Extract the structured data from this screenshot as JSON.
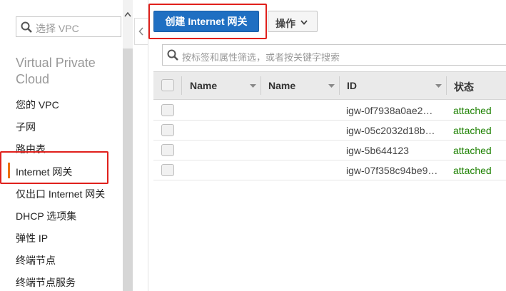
{
  "sidebar": {
    "search_placeholder": "选择 VPC",
    "title": "Virtual Private Cloud",
    "items": [
      {
        "label": "您的 VPC"
      },
      {
        "label": "子网"
      },
      {
        "label": "路由表"
      },
      {
        "label": "Internet 网关",
        "active": true
      },
      {
        "label": "仅出口 Internet 网关"
      },
      {
        "label": "DHCP 选项集"
      },
      {
        "label": "弹性 IP"
      },
      {
        "label": "终端节点"
      },
      {
        "label": "终端节点服务"
      }
    ]
  },
  "toolbar": {
    "create_label": "创建 Internet 网关",
    "actions_label": "操作"
  },
  "filter": {
    "placeholder": "按标签和属性筛选，或者按关键字搜索"
  },
  "table": {
    "columns": [
      "Name",
      "Name",
      "ID",
      "状态"
    ],
    "rows": [
      {
        "name": "",
        "name2": "",
        "id": "igw-0f7938a0ae2…",
        "state": "attached"
      },
      {
        "name": "",
        "name2": "",
        "id": "igw-05c2032d18b…",
        "state": "attached"
      },
      {
        "name": "",
        "name2": "",
        "id": "igw-5b644123",
        "state": "attached"
      },
      {
        "name": "",
        "name2": "",
        "id": "igw-07f358c94be9…",
        "state": "attached"
      }
    ]
  },
  "colors": {
    "primary_button": "#1f6fc2",
    "highlight_box": "#e0201c",
    "active_indicator": "#ec7211",
    "state_attached": "#1d8102"
  }
}
